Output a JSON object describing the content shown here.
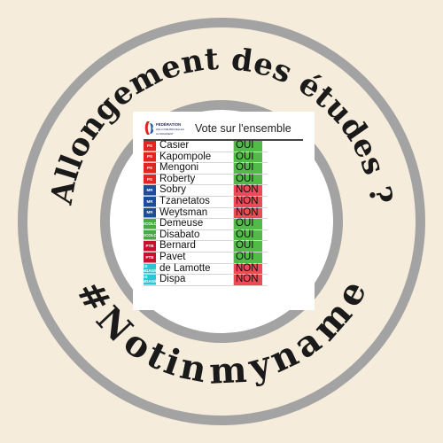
{
  "badge": {
    "top_text": "Allongement des études ?",
    "bottom_text": "#Notinmyname",
    "background_color": "#f5ecdb",
    "ring_color": "#a3a3a3",
    "inner_color": "#ffffff"
  },
  "card": {
    "logo": {
      "line1": "FÉDÉRATION",
      "line2": "WALLONIE-BRUXELLES",
      "line3": "LE PARLEMENT"
    },
    "title": "Vote sur l'ensemble",
    "rows": [
      {
        "party": "PS",
        "party_color": "#e2251f",
        "name": "Casier",
        "vote": "OUI",
        "vote_color": "#53b948"
      },
      {
        "party": "PS",
        "party_color": "#e2251f",
        "name": "Kapompole",
        "vote": "OUI",
        "vote_color": "#53b948"
      },
      {
        "party": "PS",
        "party_color": "#e2251f",
        "name": "Mengoni",
        "vote": "OUI",
        "vote_color": "#53b948"
      },
      {
        "party": "PS",
        "party_color": "#e2251f",
        "name": "Roberty",
        "vote": "OUI",
        "vote_color": "#53b948"
      },
      {
        "party": "MR",
        "party_color": "#1a4e9a",
        "name": "Sobry",
        "vote": "NON",
        "vote_color": "#ea4b57"
      },
      {
        "party": "MR",
        "party_color": "#1a4e9a",
        "name": "Tzanetatos",
        "vote": "NON",
        "vote_color": "#ea4b57"
      },
      {
        "party": "MR",
        "party_color": "#1a4e9a",
        "name": "Weytsman",
        "vote": "NON",
        "vote_color": "#ea4b57"
      },
      {
        "party": "ECOLO",
        "party_color": "#49a942",
        "name": "Demeuse",
        "vote": "OUI",
        "vote_color": "#53b948"
      },
      {
        "party": "ECOLO",
        "party_color": "#49a942",
        "name": "Disabato",
        "vote": "OUI",
        "vote_color": "#53b948"
      },
      {
        "party": "PTB",
        "party_color": "#c8102e",
        "name": "Bernard",
        "vote": "OUI",
        "vote_color": "#53b948"
      },
      {
        "party": "PTB",
        "party_color": "#c8102e",
        "name": "Pavet",
        "vote": "OUI",
        "vote_color": "#53b948"
      },
      {
        "party": "LES ENGAGÉS",
        "party_color": "#2ec4d6",
        "name": "de Lamotte",
        "vote": "NON",
        "vote_color": "#ea4b57"
      },
      {
        "party": "LES ENGAGÉS",
        "party_color": "#2ec4d6",
        "name": "Dispa",
        "vote": "NON",
        "vote_color": "#ea4b57"
      }
    ]
  }
}
